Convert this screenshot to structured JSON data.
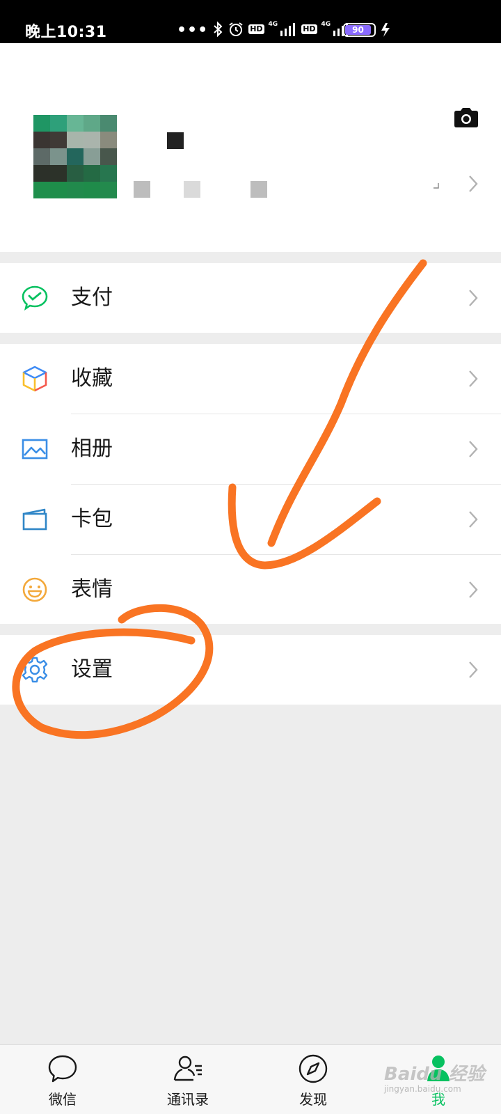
{
  "status_bar": {
    "time": "晚上10:31",
    "network_1": "4G",
    "network_2": "4G",
    "hd_1": "HD",
    "hd_2": "HD",
    "battery": "90",
    "battery_level": 0.9
  },
  "profile": {
    "avatar_icon": "pixelated-avatar",
    "camera_icon": "camera-icon"
  },
  "menu": {
    "pay": "支付",
    "favorites": "收藏",
    "album": "相册",
    "cards": "卡包",
    "stickers": "表情",
    "settings": "设置"
  },
  "tabs": [
    {
      "label": "微信",
      "icon": "chat-bubble-icon",
      "active": false
    },
    {
      "label": "通讯录",
      "icon": "contacts-icon",
      "active": false
    },
    {
      "label": "发现",
      "icon": "compass-icon",
      "active": false
    },
    {
      "label": "我",
      "icon": "me-icon",
      "active": true
    }
  ],
  "colors": {
    "accent": "#07c160",
    "annotation": "#f97423",
    "background": "#ededed"
  },
  "watermark": {
    "brand": "Baidu 经验",
    "url": "jingyan.baidu.com"
  }
}
